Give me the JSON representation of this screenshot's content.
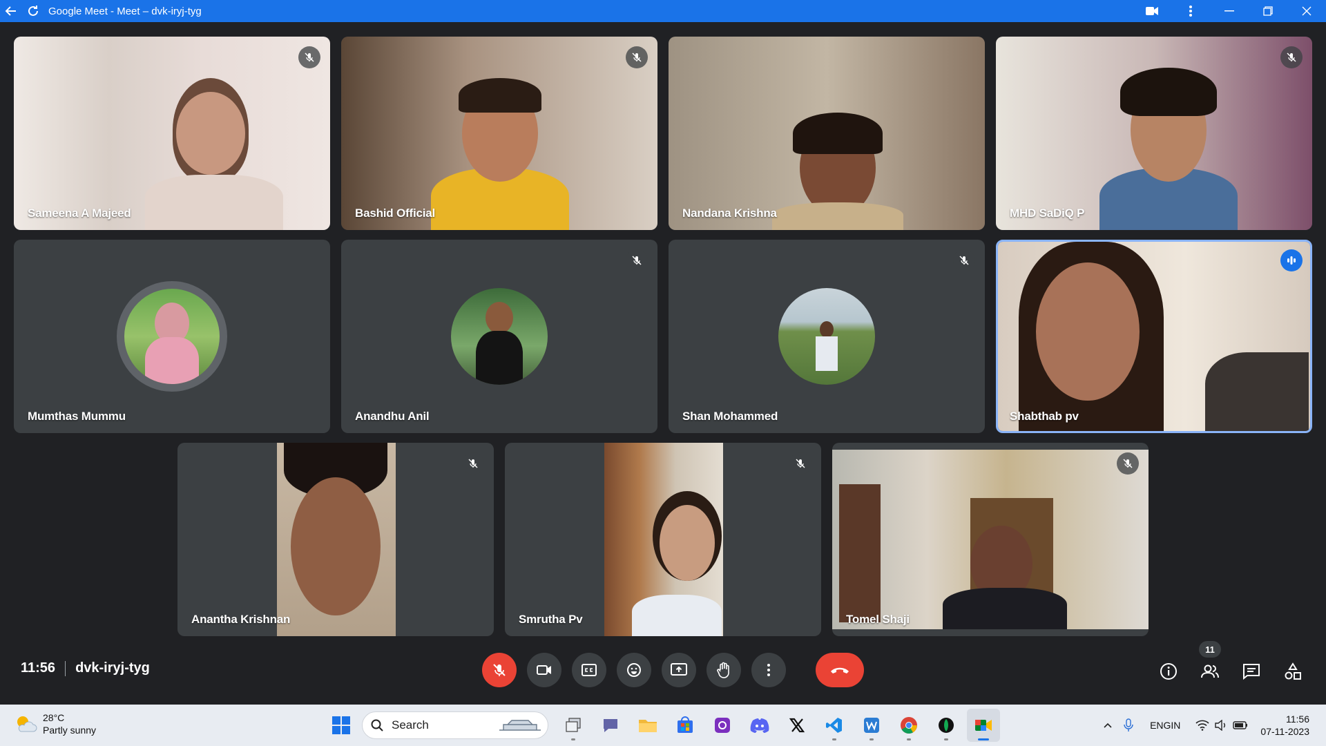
{
  "window": {
    "title": "Google Meet - Meet – dvk-iryj-tyg"
  },
  "participants": [
    {
      "name": "Sameena A Majeed",
      "muted": true
    },
    {
      "name": "Bashid Official",
      "muted": true
    },
    {
      "name": "Nandana Krishna",
      "muted": false
    },
    {
      "name": "MHD SaDiQ P",
      "muted": true
    },
    {
      "name": "Mumthas Mummu",
      "muted": false
    },
    {
      "name": "Anandhu Anil",
      "muted": true
    },
    {
      "name": "Shan Mohammed",
      "muted": true
    },
    {
      "name": "Shabthab pv",
      "speaking": true
    },
    {
      "name": "Anantha Krishnan",
      "muted": true
    },
    {
      "name": "Smrutha Pv",
      "muted": true
    },
    {
      "name": "Tomel Shaji",
      "muted": true
    }
  ],
  "meeting": {
    "time": "11:56",
    "code": "dvk-iryj-tyg",
    "participant_count": "11"
  },
  "controls": [
    "mic-off",
    "camera",
    "captions",
    "emoji",
    "present",
    "raise-hand",
    "more",
    "leave-call"
  ],
  "taskbar": {
    "weather": {
      "temp": "28°C",
      "condition": "Partly sunny"
    },
    "search_label": "Search",
    "tray": {
      "lang_line1": "ENG",
      "lang_line2": "IN",
      "time": "11:56",
      "date": "07-11-2023"
    }
  },
  "colors": {
    "accent": "#1a73e8",
    "background": "#202124",
    "tile": "#3c4043",
    "danger": "#ea4335"
  }
}
